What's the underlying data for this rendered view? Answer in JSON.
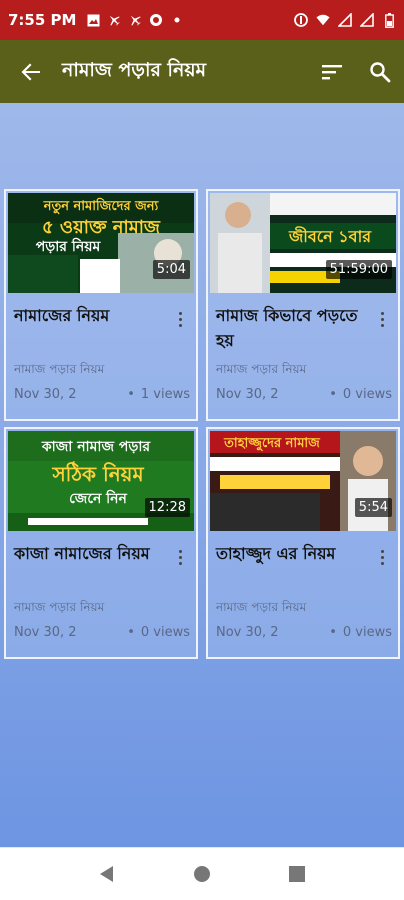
{
  "status_bar": {
    "time": "7:55 PM",
    "left_icons": [
      "image-icon",
      "airplane-icon",
      "airplane-icon",
      "sync-icon",
      "dot-icon"
    ],
    "right_icons": [
      "cast-icon",
      "wifi-icon",
      "signal-icon",
      "signal-icon",
      "battery-icon"
    ]
  },
  "app_bar": {
    "title": "নামাজ পড়ার নিয়ম",
    "back_icon": "arrow-back-icon",
    "sort_icon": "sort-icon",
    "search_icon": "search-icon"
  },
  "videos": [
    {
      "title": "নামাজের নিয়ম",
      "channel": "নামাজ পড়ার নিয়ম",
      "date": "Nov 30, 2",
      "views": "1 views",
      "duration": "5:04",
      "thumb_line1": "নতুন নামাজিদের জন্য",
      "thumb_line2": "৫ ওয়াক্ত নামাজ",
      "thumb_line3": "পড়ার নিয়ম"
    },
    {
      "title": "নামাজ কিভাবে পড়তে হয়",
      "channel": "নামাজ পড়ার নিয়ম",
      "date": "Nov 30, 2",
      "views": "0 views",
      "duration": "51:59:00",
      "thumb_line1": "জীবনে ১বার",
      "thumb_line2": "",
      "thumb_line3": ""
    },
    {
      "title": "কাজা নামাজের নিয়ম",
      "channel": "নামাজ পড়ার নিয়ম",
      "date": "Nov 30, 2",
      "views": "0 views",
      "duration": "12:28",
      "thumb_line1": "কাজা নামাজ পড়ার",
      "thumb_line2": "সঠিক নিয়ম",
      "thumb_line3": "জেনে নিন"
    },
    {
      "title": "তাহাজ্জুদ এর নিয়ম",
      "channel": "নামাজ পড়ার নিয়ম",
      "date": "Nov 30, 2",
      "views": "0 views",
      "duration": "5:54",
      "thumb_line1": "তাহাজ্জুদের নামাজ",
      "thumb_line2": "",
      "thumb_line3": ""
    }
  ],
  "nav_bar": {
    "back_icon": "nav-back-icon",
    "home_icon": "nav-home-icon",
    "recents_icon": "nav-recents-icon"
  }
}
